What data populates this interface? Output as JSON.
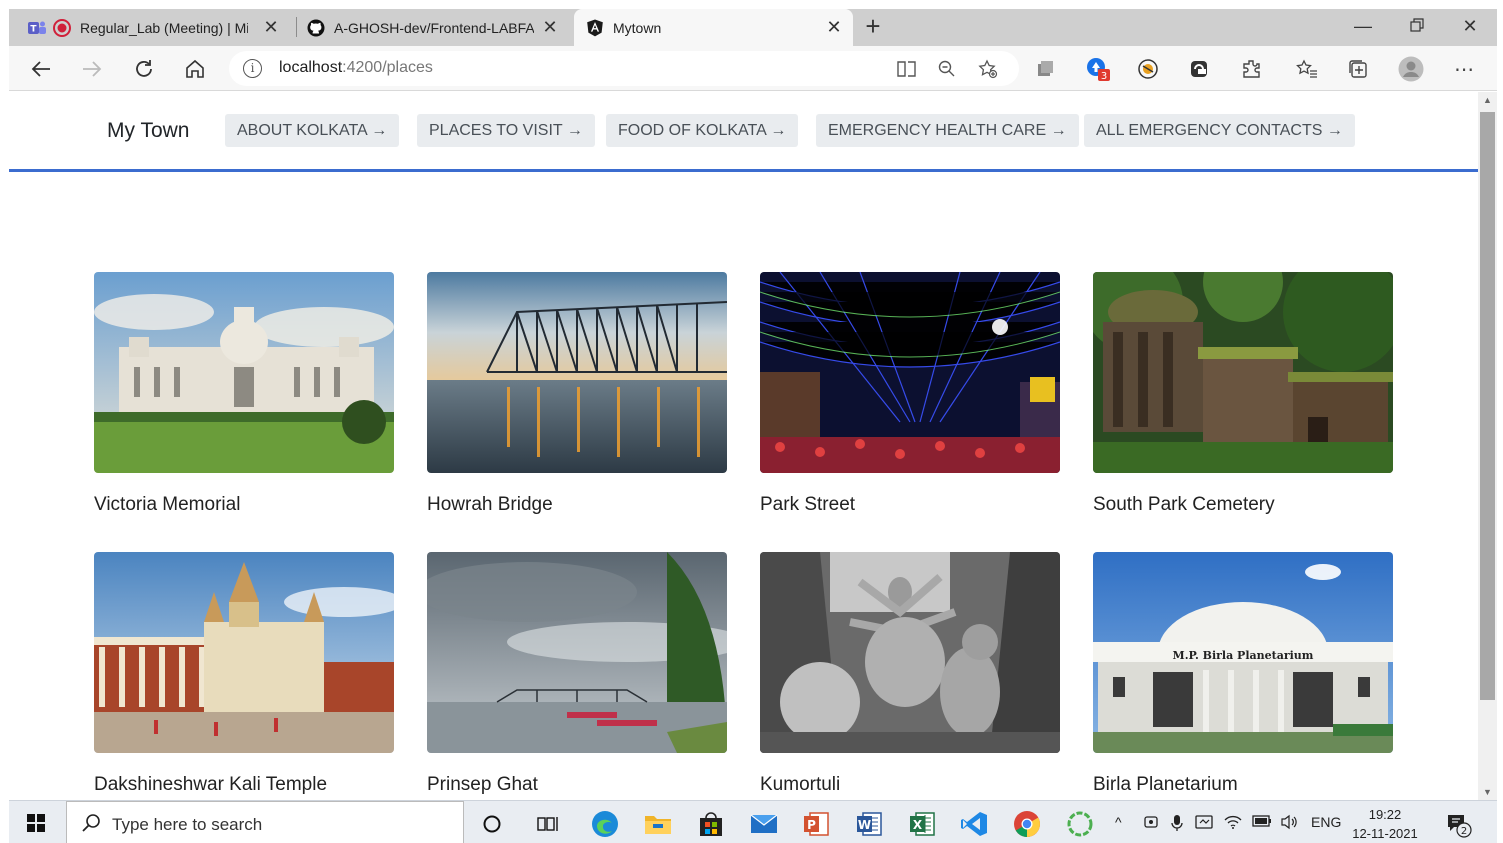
{
  "browser": {
    "tabs": [
      {
        "title": "Regular_Lab (Meeting) | Microsoft Teams",
        "icon": "teams-icon"
      },
      {
        "title": "A-GHOSH-dev/Frontend-LABFAT",
        "icon": "github-icon"
      },
      {
        "title": "Mytown",
        "icon": "angular-icon",
        "active": true
      }
    ],
    "url_host": "localhost",
    "url_path": ":4200/places",
    "extension_badge": "3"
  },
  "app": {
    "brand": "My Town",
    "nav": [
      {
        "label": "ABOUT KOLKATA →"
      },
      {
        "label": "PLACES TO VISIT →"
      },
      {
        "label": "FOOD OF KOLKATA →"
      },
      {
        "label": "EMERGENCY HEALTH CARE →"
      },
      {
        "label": "ALL EMERGENCY CONTACTS →"
      }
    ]
  },
  "places": [
    {
      "name": "Victoria Memorial"
    },
    {
      "name": "Howrah Bridge"
    },
    {
      "name": "Park Street"
    },
    {
      "name": "South Park Cemetery"
    },
    {
      "name": "Dakshineshwar Kali Temple"
    },
    {
      "name": "Prinsep Ghat"
    },
    {
      "name": "Kumortuli"
    },
    {
      "name": "Birla Planetarium",
      "sign_text": "M.P. Birla Planetarium"
    }
  ],
  "taskbar": {
    "search_placeholder": "Type here to search",
    "language": "ENG",
    "time": "19:22",
    "date": "12-11-2021",
    "notification_count": "2"
  },
  "colors": {
    "accent_line": "#3b6ccf",
    "nav_button_bg": "#e9ecef",
    "nav_button_text": "#495057"
  }
}
